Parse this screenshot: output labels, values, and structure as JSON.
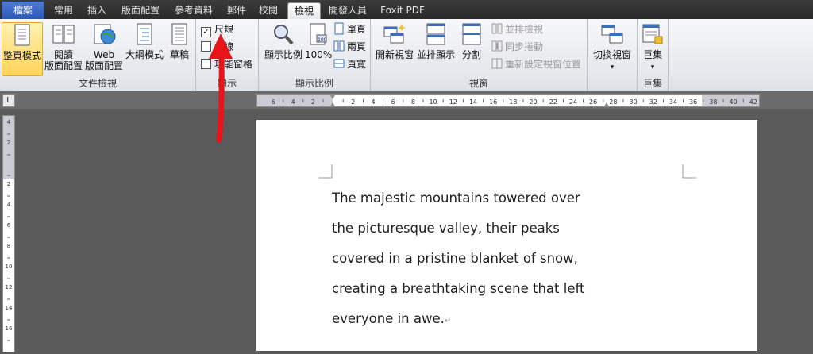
{
  "tabs": [
    {
      "label": "檔案",
      "type": "file"
    },
    {
      "label": "常用"
    },
    {
      "label": "插入"
    },
    {
      "label": "版面配置"
    },
    {
      "label": "參考資料"
    },
    {
      "label": "郵件"
    },
    {
      "label": "校閱"
    },
    {
      "label": "檢視",
      "active": true
    },
    {
      "label": "開發人員"
    },
    {
      "label": "Foxit PDF"
    }
  ],
  "groups": {
    "document_views": {
      "label": "文件檢視",
      "print_layout": "整頁模式",
      "reading_line1": "閱讀",
      "reading_line2": "版面配置",
      "web_line1": "Web",
      "web_line2": "版面配置",
      "outline": "大綱模式",
      "draft": "草稿"
    },
    "show": {
      "label": "顯示",
      "ruler": "尺規",
      "gridlines": "格線",
      "nav_pane": "功能窗格",
      "ruler_checked": "✓"
    },
    "zoom": {
      "label": "顯示比例",
      "zoom": "顯示比例",
      "hundred": "100%",
      "one_page": "單頁",
      "two_pages": "兩頁",
      "page_width": "頁寬"
    },
    "window": {
      "label": "視窗",
      "new_window": "開新視窗",
      "arrange_all": "並排顯示",
      "split": "分割",
      "side_by_side": "並排檢視",
      "sync_scroll": "同步捲動",
      "reset_position": "重新設定視窗位置",
      "switch_windows": "切換視窗",
      "dropdown_mark": "▾"
    },
    "macros": {
      "label": "巨集",
      "macros": "巨集",
      "dropdown_mark": "▾"
    }
  },
  "ruler": {
    "corner_symbol": "L",
    "h_ticks": [
      "6",
      "4",
      "2",
      "",
      "2",
      "4",
      "6",
      "8",
      "10",
      "12",
      "14",
      "16",
      "18",
      "20",
      "22",
      "24",
      "26",
      "28",
      "30",
      "32",
      "34",
      "36",
      "38",
      "40",
      "42"
    ],
    "v_ticks": [
      "4",
      "2",
      "",
      "2",
      "4",
      "6",
      "8",
      "10",
      "12",
      "14",
      "16"
    ]
  },
  "document": {
    "lines": [
      "The majestic mountains towered over",
      "the picturesque valley, their peaks",
      "covered in a pristine blanket of snow,",
      "creating a breathtaking scene that left",
      "everyone in awe."
    ],
    "paragraph_mark": "↵"
  },
  "colors": {
    "arrow": "#e8141a",
    "accent_active": "#ffd35a",
    "file_tab": "#2a58b8"
  }
}
